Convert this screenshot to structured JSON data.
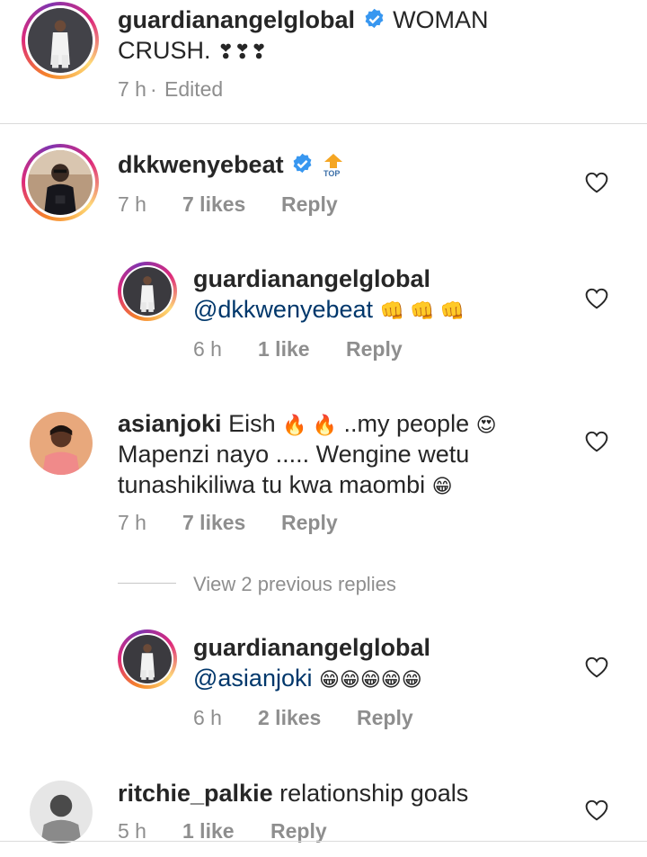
{
  "colors": {
    "link": "#00376b",
    "meta": "#8e8e8e",
    "text": "#262626",
    "verified": "#3897f0",
    "top_badge": "#f5a623"
  },
  "caption": {
    "username": "guardianangelglobal",
    "text_line1": "WOMAN",
    "text_line2": "CRUSH. ",
    "emoji_line2": "❣❣❣",
    "time": "7 h",
    "separator": "·",
    "edited": "Edited"
  },
  "comments": [
    {
      "username": "dkkwenyebeat",
      "badge": "TOP",
      "time": "7 h",
      "likes": "7 likes",
      "reply": "Reply",
      "replies": [
        {
          "username": "guardianangelglobal",
          "mention": "@dkkwenyebeat",
          "emoji": "👊 👊 👊",
          "time": "6 h",
          "likes": "1 like",
          "reply": "Reply"
        }
      ]
    },
    {
      "username": "asianjoki",
      "text_line1": "Eish ",
      "emoji_fire": "🔥 🔥",
      "text_line1_b": " ..my people ",
      "emoji_heart_eyes": "😍",
      "text_line2": "Mapenzi nayo ..... Wengine wetu",
      "text_line3": "tunashikiliwa tu kwa maombi ",
      "emoji_grin": "😁",
      "time": "7 h",
      "likes": "7 likes",
      "reply": "Reply",
      "view_previous": "View 2 previous replies",
      "replies": [
        {
          "username": "guardianangelglobal",
          "mention": "@asianjoki",
          "emoji": "😁😁😁😁😁",
          "time": "6 h",
          "likes": "2 likes",
          "reply": "Reply"
        }
      ]
    },
    {
      "username": "ritchie_palkie",
      "text": "relationship goals",
      "time": "5 h",
      "likes": "1 like",
      "reply": "Reply"
    }
  ]
}
